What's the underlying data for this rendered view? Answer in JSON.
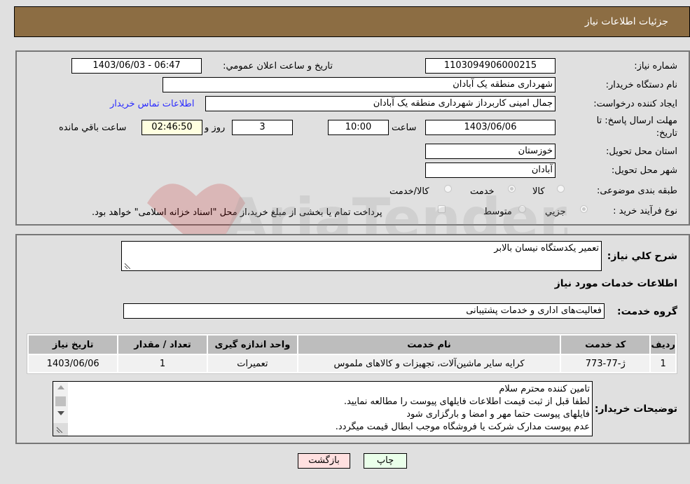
{
  "header": {
    "title": "جزئیات اطلاعات نیاز"
  },
  "form": {
    "need_number": {
      "label": "شماره نیاز:",
      "value": "1103094906000215"
    },
    "announce_datetime": {
      "label": "تاریخ و ساعت اعلان عمومي:",
      "value": "1403/06/03 - 06:47"
    },
    "buyer_org": {
      "label": "نام دستگاه خريدار:",
      "value": "شهرداری منطقه یک آبادان"
    },
    "creator": {
      "label": "ایجاد کننده درخواست:",
      "value": "جمال امینی کاربرداز شهرداری منطقه یک آبادان"
    },
    "buyer_contact_link": "اطلاعات تماس خريدار",
    "deadline": {
      "label_line1": "مهلت ارسال پاسخ: تا",
      "label_line2": "تاریخ:",
      "date": "1403/06/06",
      "time_label": "ساعت",
      "time": "10:00",
      "days": "3",
      "days_label": "روز و",
      "remaining": "02:46:50",
      "remaining_label": "ساعت باقي مانده"
    },
    "province": {
      "label": "استان محل تحویل:",
      "value": "خوزستان"
    },
    "city": {
      "label": "شهر محل تحویل:",
      "value": "آبادان"
    },
    "category": {
      "label": "طبقه بندی موضوعی:",
      "options": [
        {
          "label": "کالا",
          "checked": false
        },
        {
          "label": "خدمت",
          "checked": true
        },
        {
          "label": "کالا/خدمت",
          "checked": false
        }
      ]
    },
    "purchase_process": {
      "label": "نوع فرآیند خرید :",
      "options": [
        {
          "label": "جزيي",
          "checked": true
        },
        {
          "label": "متوسط",
          "checked": false
        }
      ],
      "treasury_checkbox_label": "پرداخت تمام یا بخشی از مبلغ خرید،از محل \"اسناد خزانه اسلامی\" خواهد بود."
    }
  },
  "details": {
    "description_label": "شرح کلي نياز:",
    "description_value": "تعمیر یکدستگاه نیسان بالابر",
    "services_heading": "اطلاعات خدمات مورد نیاز",
    "service_group_label": "گروه خدمت:",
    "service_group_value": "فعالیت‌های اداری و خدمات پشتیبانی",
    "table": {
      "headers": [
        "ردیف",
        "کد خدمت",
        "نام خدمت",
        "واحد اندازه گیری",
        "تعداد / مقدار",
        "تاریخ نیاز"
      ],
      "rows": [
        [
          "1",
          "ژ-77-773",
          "کرایه سایر ماشین‌آلات، تجهیزات و کالاهای ملموس",
          "تعمیرات",
          "1",
          "1403/06/06"
        ]
      ]
    },
    "buyer_notes_label": "توضیحات خریدار:",
    "buyer_notes_lines": [
      "تامین کننده محترم سلام",
      "لطفا قبل از ثبت قیمت اطلاعات فایلهای پیوست را مطالعه نمایید.",
      "فایلهای پیوست حتما مهر و امضا و بارگزاری شود",
      "عدم پیوست مدارک شرکت یا فروشگاه موجب ابطال قیمت میگردد."
    ]
  },
  "buttons": {
    "print": "چاپ",
    "back": "بازگشت"
  },
  "watermark": {
    "text": "AriaTender.neT"
  },
  "colors": {
    "header_bg": "#8c6d43",
    "link": "#2a2aff",
    "print_bg": "#eaffea",
    "back_bg": "#ffe0e0",
    "remaining_bg": "#ffffe0"
  }
}
